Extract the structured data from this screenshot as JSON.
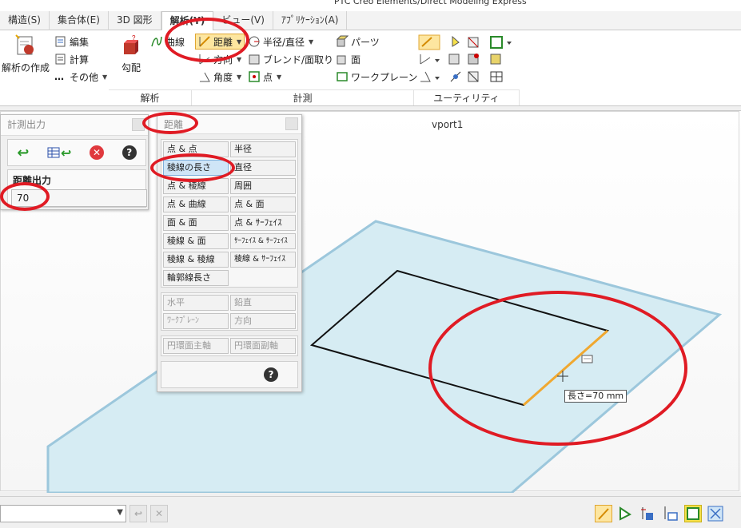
{
  "window": {
    "title": "PTC Creo Elements/Direct Modeling Express"
  },
  "tabs": [
    {
      "label": "構造(S)",
      "active": false
    },
    {
      "label": "集合体(E)",
      "active": false
    },
    {
      "label": "3D 図形",
      "active": false
    },
    {
      "label": "解析(Y)",
      "active": true
    },
    {
      "label": "ビュー(V)",
      "active": false
    },
    {
      "label": "ｱﾌﾟﾘｹｰｼｮﾝ(A)",
      "active": false
    }
  ],
  "ribbon": {
    "analysis": {
      "create_label": "解析の作成",
      "edit_label": "編集",
      "calc_label": "計算",
      "other_label": "その他",
      "gradient_label": "勾配",
      "curve_label": "曲線",
      "group_label": "解析"
    },
    "measure": {
      "distance_label": "距離",
      "direction_label": "方向",
      "angle_label": "角度",
      "radius_label": "半径/直径",
      "blend_label": "ブレンド/面取り",
      "point_label": "点",
      "part_label": "パーツ",
      "face_label": "面",
      "workplane_label": "ワークプレーン",
      "group_label": "計測"
    },
    "utility": {
      "group_label": "ユーティリティ"
    }
  },
  "viewport": {
    "title": "vport1"
  },
  "measure_output": {
    "title": "計測出力",
    "section_label": "距離出力",
    "value": "70"
  },
  "distance_panel": {
    "title": "距離",
    "group1": [
      {
        "label": "点 & 点"
      },
      {
        "label": "半径"
      },
      {
        "label": "稜線の長さ"
      },
      {
        "label": "直径"
      },
      {
        "label": "点 & 稜線"
      },
      {
        "label": "周囲"
      },
      {
        "label": "点 & 曲線"
      },
      {
        "label": "点 & 面"
      },
      {
        "label": "面 & 面"
      },
      {
        "label": "点 & ｻｰﾌｪｲｽ"
      },
      {
        "label": "稜線 & 面"
      },
      {
        "label": "ｻｰﾌｪｲｽ & ｻｰﾌｪｲｽ"
      },
      {
        "label": "稜線 & 稜線"
      },
      {
        "label": "稜線 & ｻｰﾌｪｲｽ"
      },
      {
        "label": "輪郭線長さ"
      }
    ],
    "group2": [
      {
        "label": "水平"
      },
      {
        "label": "鉛直"
      },
      {
        "label": "ﾜｰｸﾌﾟﾚｰﾝ"
      },
      {
        "label": "方向"
      }
    ],
    "group3": [
      {
        "label": "円環面主軸"
      },
      {
        "label": "円環面副軸"
      }
    ]
  },
  "tooltip": {
    "text": "長さ=70 mm"
  },
  "colors": {
    "annotation": "#e01b24",
    "plane_fill": "#d6ecf3",
    "plane_edge": "#9cc7dc",
    "highlight_edge": "#f0a830",
    "selected_button": "#fde6a0"
  }
}
